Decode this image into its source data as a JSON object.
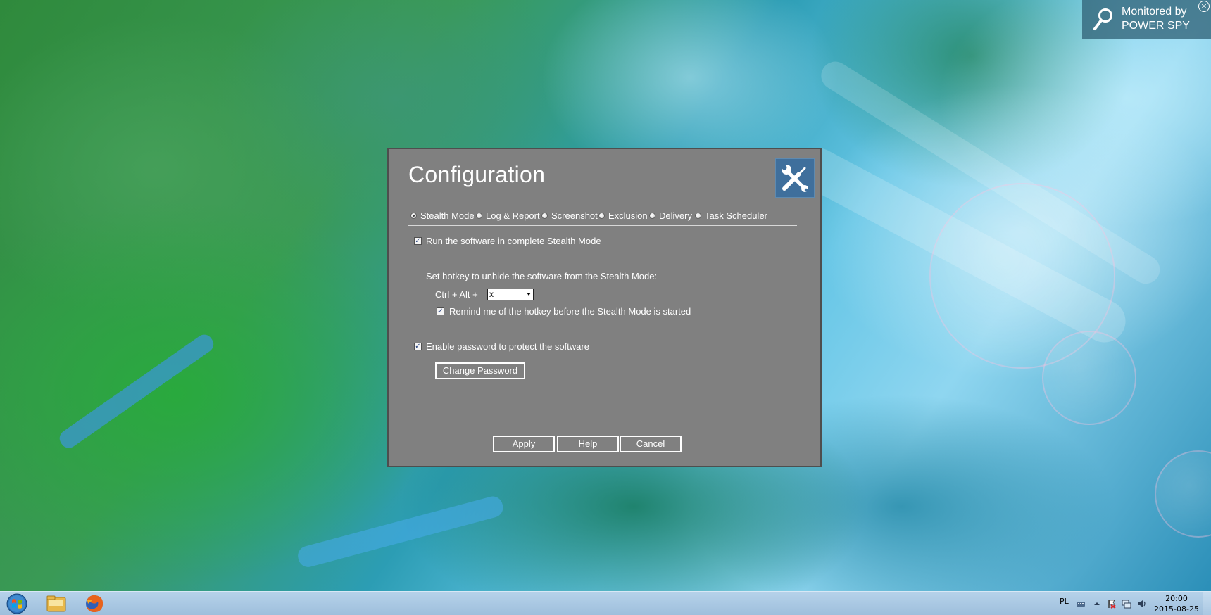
{
  "monitor_badge": {
    "line1": "Monitored by",
    "line2": "POWER SPY",
    "icon": "magnifier-icon",
    "close_icon": "close-icon"
  },
  "dialog": {
    "title": "Configuration",
    "header_icon": "tools-icon",
    "tabs": [
      {
        "label": "Stealth Mode",
        "selected": true
      },
      {
        "label": "Log & Report",
        "selected": false
      },
      {
        "label": "Screenshot",
        "selected": false
      },
      {
        "label": "Exclusion",
        "selected": false
      },
      {
        "label": "Delivery",
        "selected": false
      },
      {
        "label": "Task Scheduler",
        "selected": false
      }
    ],
    "stealth": {
      "run_stealth_label": "Run the software in complete Stealth Mode",
      "run_stealth_checked": true,
      "hotkey_heading": "Set hotkey to unhide the software from the Stealth Mode:",
      "hotkey_prefix": "Ctrl + Alt +",
      "hotkey_value": "x",
      "remind_label": "Remind me of the hotkey before the Stealth Mode is started",
      "remind_checked": true,
      "password_label": "Enable password to protect the software",
      "password_checked": true,
      "change_password_label": "Change Password"
    },
    "buttons": {
      "apply": "Apply",
      "help": "Help",
      "cancel": "Cancel"
    }
  },
  "taskbar": {
    "start_icon": "windows-start-icon",
    "apps": [
      "file-explorer-icon",
      "firefox-icon"
    ],
    "language": "PL",
    "tray_icons": [
      "keyboard-icon",
      "show-hidden-icons-icon",
      "action-center-flag-icon",
      "network-icon",
      "volume-icon"
    ],
    "time": "20:00",
    "date": "2015-08-25"
  },
  "colors": {
    "dialog_bg": "#808080",
    "dialog_icon_bg": "#3f6f9c",
    "badge_bg": "#326478",
    "taskbar": "#b6d2ea"
  }
}
